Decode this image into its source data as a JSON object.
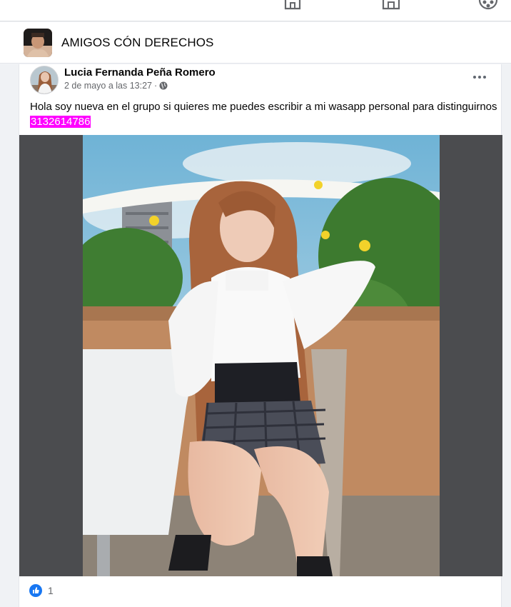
{
  "group": {
    "name": "AMIGOS CÓN DERECHOS"
  },
  "post": {
    "author": "Lucia Fernanda Peña Romero",
    "timestamp": "2 de mayo a las 13:27",
    "separator": "·",
    "text": "Hola soy nueva en el grupo si quieres me puedes escribir a mi wasapp personal para distinguirnos",
    "phone": "3132614786",
    "reaction_count": "1"
  },
  "icons": {
    "nav": [
      "home-icon",
      "marketplace-icon",
      "groups-icon"
    ],
    "privacy": "globe-icon",
    "menu": "more-options-icon",
    "reaction": "like-icon"
  },
  "colors": {
    "highlight": "#ff00ff",
    "like": "#1877f2"
  }
}
